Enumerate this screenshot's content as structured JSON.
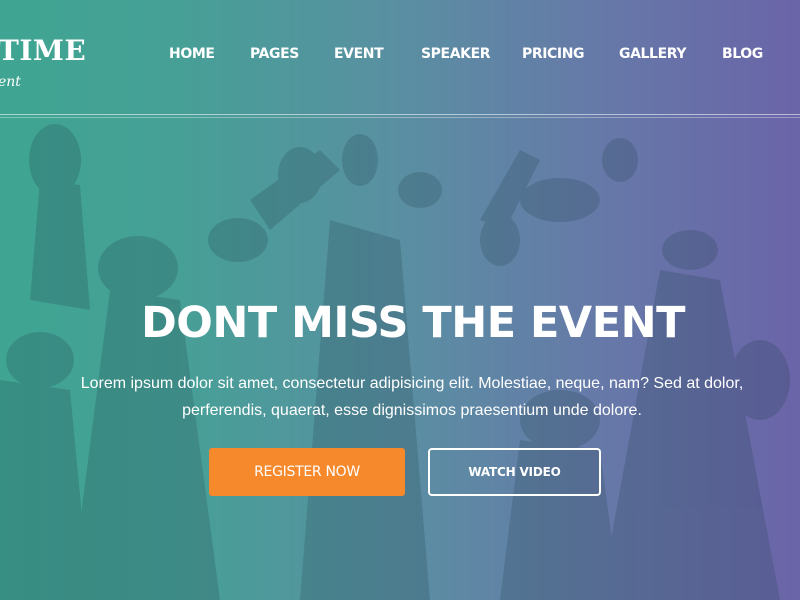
{
  "brand": {
    "title": "TIME",
    "tagline": "ent"
  },
  "nav": {
    "items": [
      {
        "label": "HOME"
      },
      {
        "label": "PAGES"
      },
      {
        "label": "EVENT"
      },
      {
        "label": "SPEAKER"
      },
      {
        "label": "PRICING"
      },
      {
        "label": "GALLERY"
      },
      {
        "label": "BLOG"
      }
    ]
  },
  "hero": {
    "title": "DONT MISS THE EVENT",
    "text": "Lorem ipsum dolor sit amet, consectetur adipisicing elit. Molestiae, neque, nam? Sed at dolor, perferendis, quaerat, esse dignissimos praesentium unde dolore.",
    "register_label": "REGISTER NOW",
    "watch_label": "WATCH VIDEO"
  },
  "colors": {
    "gradient_left": "#3fa592",
    "gradient_right": "#6a64a8",
    "register_button": "#f7892d",
    "text": "#ffffff"
  }
}
